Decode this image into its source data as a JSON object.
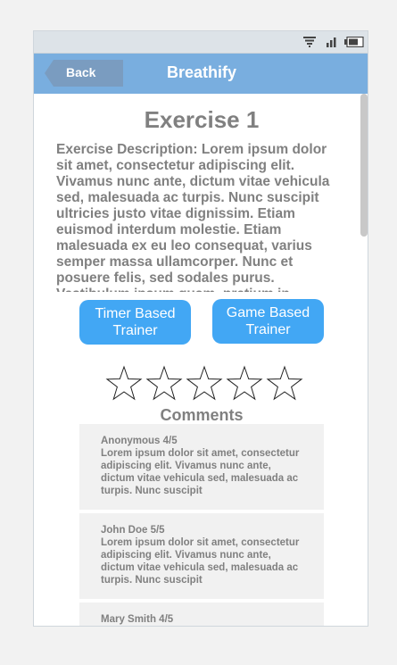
{
  "app": {
    "title": "Breathify",
    "back_label": "Back"
  },
  "status_icons": [
    "wifi-icon",
    "signal-icon",
    "battery-icon"
  ],
  "exercise": {
    "title": "Exercise 1",
    "description": "Exercise Description: Lorem ipsum dolor sit amet, consectetur adipiscing elit. Vivamus nunc ante, dictum vitae vehicula sed, malesuada ac turpis. Nunc suscipit ultricies justo vitae dignissim. Etiam euismod interdum molestie. Etiam malesuada ex eu leo consequat, varius semper massa ullamcorper. Nunc et posuere felis, sed sodales purus. Vestibulum ipsum quam, pretium in"
  },
  "buttons": {
    "timer": "Timer Based Trainer",
    "game": "Game Based Trainer"
  },
  "rating": {
    "max": 5,
    "value": 0
  },
  "comments": {
    "title": "Comments",
    "items": [
      {
        "author": "Anonymous 4/5",
        "body": "Lorem ipsum dolor sit amet, consectetur adipiscing elit. Vivamus nunc ante, dictum vitae vehicula sed, malesuada ac turpis. Nunc suscipit"
      },
      {
        "author": "John Doe 5/5",
        "body": "Lorem ipsum dolor sit amet, consectetur adipiscing elit. Vivamus nunc ante, dictum vitae vehicula sed, malesuada ac turpis. Nunc suscipit"
      },
      {
        "author": "Mary Smith 4/5",
        "body": ""
      }
    ]
  },
  "colors": {
    "navbar": "#79aedf",
    "back_button": "#7a9cc0",
    "accent_button": "#42a7f4",
    "text_gray": "#808080",
    "card_bg": "#f1f1f1"
  }
}
